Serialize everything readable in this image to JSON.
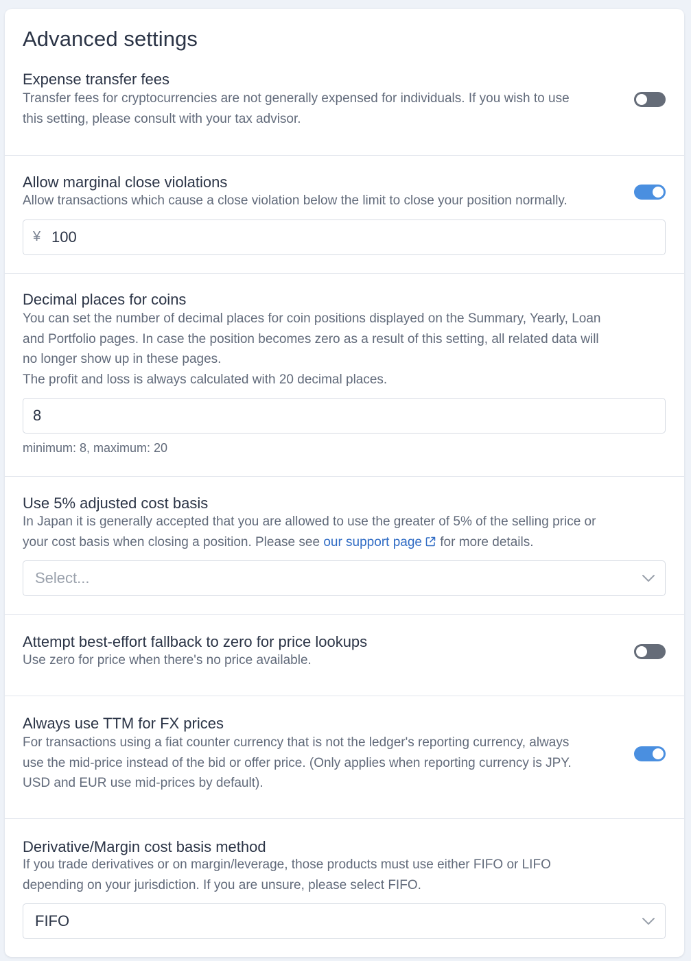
{
  "title": "Advanced settings",
  "sections": {
    "expense": {
      "title": "Expense transfer fees",
      "desc_1": "Transfer fees for cryptocurrencies are not generally expensed for individuals. If you wish to use",
      "desc_2": "this setting, please consult with your tax advisor.",
      "enabled": false
    },
    "marginal": {
      "title": "Allow marginal close violations",
      "desc_1": "Allow transactions which cause a close violation below the limit to close your position normally.",
      "enabled": true,
      "currency_symbol": "¥",
      "value": "100"
    },
    "decimals": {
      "title": "Decimal places for coins",
      "desc_1": "You can set the number of decimal places for coin positions displayed on the Summary, Yearly, Loan",
      "desc_2": "and Portfolio pages. In case the position becomes zero as a result of this setting, all related data will",
      "desc_3": "no longer show up in these pages.",
      "desc_4": "The profit and loss is always calculated with 20 decimal places.",
      "value": "8",
      "hint": "minimum: 8, maximum: 20"
    },
    "adjusted": {
      "title": "Use 5% adjusted cost basis",
      "desc_1": "In Japan it is generally accepted that you are allowed to use the greater of 5% of the selling price or",
      "desc_2_pre": "your cost basis when closing a position. Please see ",
      "link_label": "our support page",
      "desc_2_post": " for more details.",
      "placeholder": "Select..."
    },
    "fallback": {
      "title": "Attempt best-effort fallback to zero for price lookups",
      "desc_1": "Use zero for price when there's no price available.",
      "enabled": false
    },
    "ttm": {
      "title": "Always use TTM for FX prices",
      "desc_1": "For transactions using a fiat counter currency that is not the ledger's reporting currency, always",
      "desc_2": "use the mid-price instead of the bid or offer price. (Only applies when reporting currency is JPY.",
      "desc_3": "USD and EUR use mid-prices by default).",
      "enabled": true
    },
    "derivative": {
      "title": "Derivative/Margin cost basis method",
      "desc_1": "If you trade derivatives or on margin/leverage, those products must use either FIFO or LIFO",
      "desc_2": "depending on your jurisdiction. If you are unsure, please select FIFO.",
      "selected": "FIFO"
    }
  },
  "colors": {
    "toggle_on": "#4a8fe0",
    "toggle_off": "#656c78",
    "link": "#2f6bc4"
  },
  "icons": [
    "external-link-icon",
    "chevron-down-icon"
  ]
}
